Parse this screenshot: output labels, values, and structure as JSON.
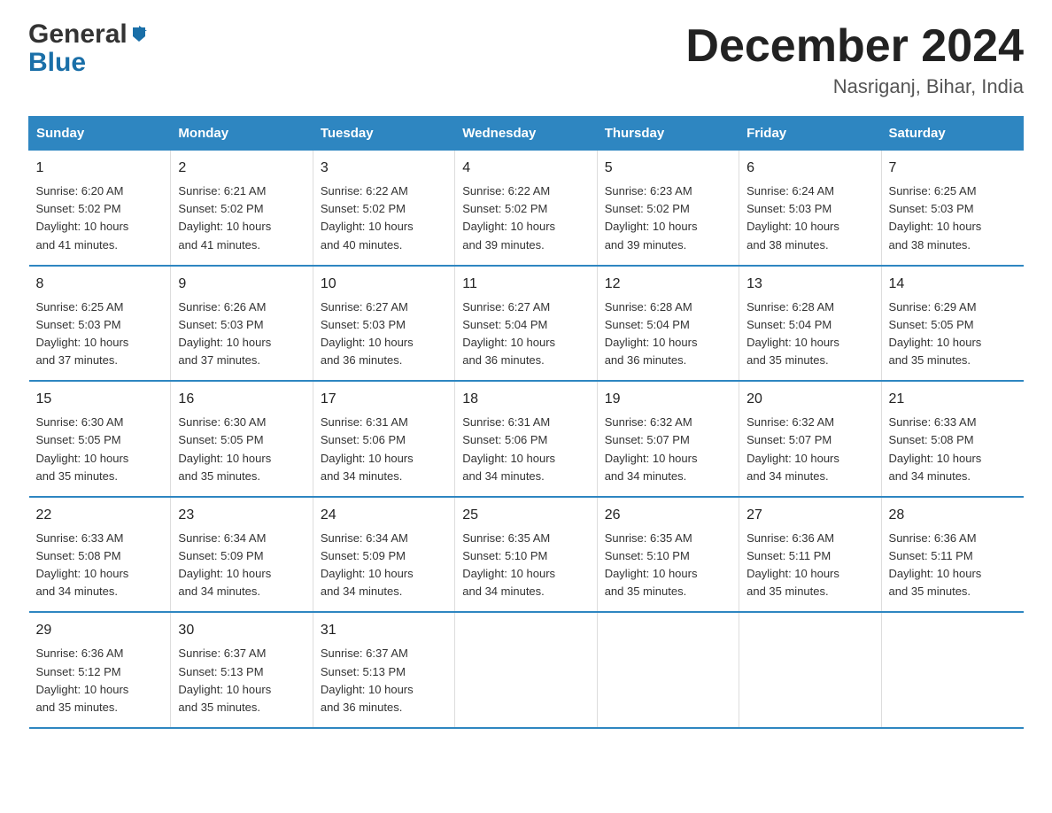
{
  "logo": {
    "general": "General",
    "blue": "Blue"
  },
  "title": "December 2024",
  "subtitle": "Nasriganj, Bihar, India",
  "days_of_week": [
    "Sunday",
    "Monday",
    "Tuesday",
    "Wednesday",
    "Thursday",
    "Friday",
    "Saturday"
  ],
  "weeks": [
    [
      {
        "day": "1",
        "sunrise": "6:20 AM",
        "sunset": "5:02 PM",
        "daylight": "10 hours and 41 minutes."
      },
      {
        "day": "2",
        "sunrise": "6:21 AM",
        "sunset": "5:02 PM",
        "daylight": "10 hours and 41 minutes."
      },
      {
        "day": "3",
        "sunrise": "6:22 AM",
        "sunset": "5:02 PM",
        "daylight": "10 hours and 40 minutes."
      },
      {
        "day": "4",
        "sunrise": "6:22 AM",
        "sunset": "5:02 PM",
        "daylight": "10 hours and 39 minutes."
      },
      {
        "day": "5",
        "sunrise": "6:23 AM",
        "sunset": "5:02 PM",
        "daylight": "10 hours and 39 minutes."
      },
      {
        "day": "6",
        "sunrise": "6:24 AM",
        "sunset": "5:03 PM",
        "daylight": "10 hours and 38 minutes."
      },
      {
        "day": "7",
        "sunrise": "6:25 AM",
        "sunset": "5:03 PM",
        "daylight": "10 hours and 38 minutes."
      }
    ],
    [
      {
        "day": "8",
        "sunrise": "6:25 AM",
        "sunset": "5:03 PM",
        "daylight": "10 hours and 37 minutes."
      },
      {
        "day": "9",
        "sunrise": "6:26 AM",
        "sunset": "5:03 PM",
        "daylight": "10 hours and 37 minutes."
      },
      {
        "day": "10",
        "sunrise": "6:27 AM",
        "sunset": "5:03 PM",
        "daylight": "10 hours and 36 minutes."
      },
      {
        "day": "11",
        "sunrise": "6:27 AM",
        "sunset": "5:04 PM",
        "daylight": "10 hours and 36 minutes."
      },
      {
        "day": "12",
        "sunrise": "6:28 AM",
        "sunset": "5:04 PM",
        "daylight": "10 hours and 36 minutes."
      },
      {
        "day": "13",
        "sunrise": "6:28 AM",
        "sunset": "5:04 PM",
        "daylight": "10 hours and 35 minutes."
      },
      {
        "day": "14",
        "sunrise": "6:29 AM",
        "sunset": "5:05 PM",
        "daylight": "10 hours and 35 minutes."
      }
    ],
    [
      {
        "day": "15",
        "sunrise": "6:30 AM",
        "sunset": "5:05 PM",
        "daylight": "10 hours and 35 minutes."
      },
      {
        "day": "16",
        "sunrise": "6:30 AM",
        "sunset": "5:05 PM",
        "daylight": "10 hours and 35 minutes."
      },
      {
        "day": "17",
        "sunrise": "6:31 AM",
        "sunset": "5:06 PM",
        "daylight": "10 hours and 34 minutes."
      },
      {
        "day": "18",
        "sunrise": "6:31 AM",
        "sunset": "5:06 PM",
        "daylight": "10 hours and 34 minutes."
      },
      {
        "day": "19",
        "sunrise": "6:32 AM",
        "sunset": "5:07 PM",
        "daylight": "10 hours and 34 minutes."
      },
      {
        "day": "20",
        "sunrise": "6:32 AM",
        "sunset": "5:07 PM",
        "daylight": "10 hours and 34 minutes."
      },
      {
        "day": "21",
        "sunrise": "6:33 AM",
        "sunset": "5:08 PM",
        "daylight": "10 hours and 34 minutes."
      }
    ],
    [
      {
        "day": "22",
        "sunrise": "6:33 AM",
        "sunset": "5:08 PM",
        "daylight": "10 hours and 34 minutes."
      },
      {
        "day": "23",
        "sunrise": "6:34 AM",
        "sunset": "5:09 PM",
        "daylight": "10 hours and 34 minutes."
      },
      {
        "day": "24",
        "sunrise": "6:34 AM",
        "sunset": "5:09 PM",
        "daylight": "10 hours and 34 minutes."
      },
      {
        "day": "25",
        "sunrise": "6:35 AM",
        "sunset": "5:10 PM",
        "daylight": "10 hours and 34 minutes."
      },
      {
        "day": "26",
        "sunrise": "6:35 AM",
        "sunset": "5:10 PM",
        "daylight": "10 hours and 35 minutes."
      },
      {
        "day": "27",
        "sunrise": "6:36 AM",
        "sunset": "5:11 PM",
        "daylight": "10 hours and 35 minutes."
      },
      {
        "day": "28",
        "sunrise": "6:36 AM",
        "sunset": "5:11 PM",
        "daylight": "10 hours and 35 minutes."
      }
    ],
    [
      {
        "day": "29",
        "sunrise": "6:36 AM",
        "sunset": "5:12 PM",
        "daylight": "10 hours and 35 minutes."
      },
      {
        "day": "30",
        "sunrise": "6:37 AM",
        "sunset": "5:13 PM",
        "daylight": "10 hours and 35 minutes."
      },
      {
        "day": "31",
        "sunrise": "6:37 AM",
        "sunset": "5:13 PM",
        "daylight": "10 hours and 36 minutes."
      },
      null,
      null,
      null,
      null
    ]
  ],
  "labels": {
    "sunrise": "Sunrise:",
    "sunset": "Sunset:",
    "daylight": "Daylight:"
  }
}
